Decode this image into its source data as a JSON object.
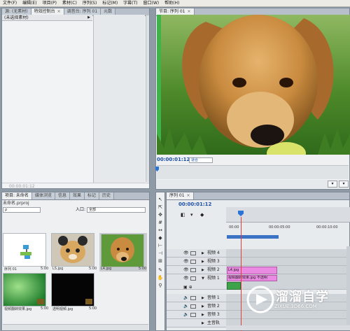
{
  "menubar": {
    "items": [
      "文件(F)",
      "编辑(E)",
      "项目(P)",
      "素材(C)",
      "序列(S)",
      "标记(M)",
      "字幕(T)",
      "窗口(W)",
      "帮助(H)"
    ]
  },
  "effects_panel": {
    "tabs": [
      "源: (无素材)",
      "特效控制台",
      "调音台: 序列 01",
      "元数"
    ],
    "selector_text": "(未选择素材)",
    "timecode": "00:00:01:12"
  },
  "program_monitor": {
    "tab": "节目: 序列 01",
    "timecode": "00:00:01:12",
    "fit_select": "适合"
  },
  "project_panel": {
    "tabs": [
      "项目: 未命名",
      "媒体浏览",
      "信息",
      "效果",
      "标记",
      "历史"
    ],
    "file_name": "未命名.prproj",
    "search_placeholder": "ρ",
    "entry_label": "入口:",
    "entry_value": "全部",
    "items": [
      {
        "label": "序列 01",
        "duration": "5:00",
        "kind": "sequence"
      },
      {
        "label": "LS.jpg",
        "duration": "5:00",
        "kind": "cat"
      },
      {
        "label": "L4.jpg",
        "duration": "5:00",
        "kind": "dog"
      },
      {
        "label": "视频翻转效果.jpg",
        "duration": "5:00",
        "kind": "green"
      },
      {
        "label": "透明视频.jpg",
        "duration": "5:00",
        "kind": "black"
      }
    ]
  },
  "timeline": {
    "tab": "序列 01",
    "timecode": "00:00:01:12",
    "ruler_labels": [
      "00:00",
      "00:00:05:00",
      "00:00:10:00"
    ],
    "tracks": [
      {
        "name": "视频 4",
        "type": "video"
      },
      {
        "name": "视频 3",
        "type": "video"
      },
      {
        "name": "视频 2",
        "type": "video"
      },
      {
        "name": "视频 1",
        "type": "video"
      },
      {
        "name": "音频 1",
        "type": "audio"
      },
      {
        "name": "音频 2",
        "type": "audio"
      },
      {
        "name": "音频 3",
        "type": "audio"
      },
      {
        "name": "主音轨",
        "type": "master"
      }
    ],
    "clips": {
      "v2_label": "L4.jpg",
      "v1_label": "视频翻转效果.jpg",
      "v1_badge": "不透明"
    }
  },
  "watermark": {
    "title": "溜溜自学",
    "url": "ZIXUE.3D66.COM"
  },
  "colors": {
    "accent_blue": "#2a74d5",
    "playhead_red": "#e23b3b",
    "clip_pink": "#e98be0",
    "clip_green": "#3da34a"
  }
}
